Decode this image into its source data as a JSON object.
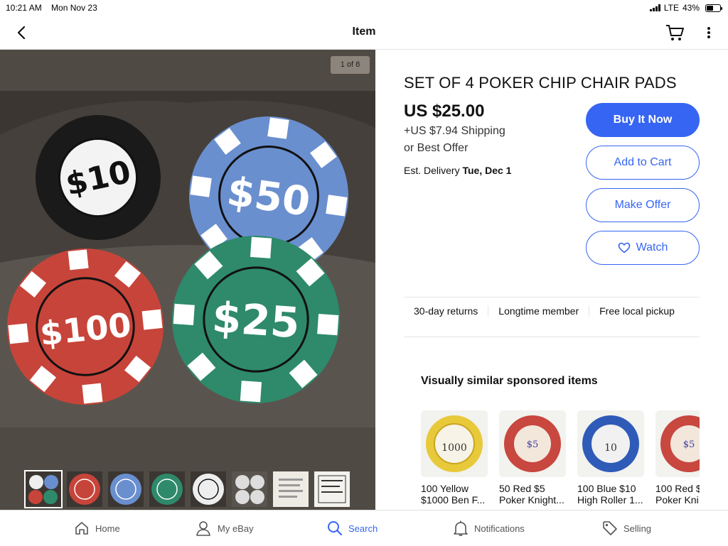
{
  "status_bar": {
    "time": "10:21 AM",
    "date": "Mon Nov 23",
    "network": "LTE",
    "battery": "43%",
    "battery_level": 0.43
  },
  "nav": {
    "title": "Item",
    "back_icon": "chevron-left-icon",
    "cart_icon": "cart-icon",
    "more_icon": "more-vertical-icon"
  },
  "gallery": {
    "counter": "1 of 8",
    "chips": [
      {
        "label": "$10",
        "color": "#1a1a1a",
        "base": "#f3f3f3"
      },
      {
        "label": "$50",
        "color": "#6a8fcf",
        "base": "#ffffff"
      },
      {
        "label": "$100",
        "color": "#c7443a",
        "base": "#ffffff"
      },
      {
        "label": "$25",
        "color": "#2e8a6a",
        "base": "#ffffff"
      }
    ]
  },
  "item": {
    "title": "SET OF 4 POKER CHIP CHAIR PADS",
    "price": "US $25.00",
    "shipping": "+US $7.94 Shipping",
    "best_offer": "or Best Offer",
    "delivery_label": "Est. Delivery",
    "delivery_date": "Tue, Dec 1"
  },
  "actions": {
    "buy_now": "Buy It Now",
    "add_to_cart": "Add to Cart",
    "make_offer": "Make Offer",
    "watch": "Watch",
    "accent": "#3665f3"
  },
  "features": [
    "30-day returns",
    "Longtime member",
    "Free local pickup"
  ],
  "sponsored": {
    "heading": "Visually similar sponsored items",
    "items": [
      {
        "line1": "100 Yellow",
        "line2": "$1000 Ben F...",
        "chip_color": "#e8c93a",
        "chip_text": "1000"
      },
      {
        "line1": "50 Red $5",
        "line2": "Poker Knight...",
        "chip_color": "#c8473f",
        "chip_text": "$5"
      },
      {
        "line1": "100 Blue $10",
        "line2": "High Roller 1...",
        "chip_color": "#2f5bb8",
        "chip_text": "10"
      },
      {
        "line1": "100 Red $",
        "line2": "Poker Kni",
        "chip_color": "#c8473f",
        "chip_text": "$5"
      }
    ]
  },
  "tabbar": {
    "items": [
      {
        "label": "Home",
        "icon": "home-icon"
      },
      {
        "label": "My eBay",
        "icon": "person-icon"
      },
      {
        "label": "Search",
        "icon": "search-icon"
      },
      {
        "label": "Notifications",
        "icon": "bell-icon"
      },
      {
        "label": "Selling",
        "icon": "tag-icon"
      }
    ]
  }
}
